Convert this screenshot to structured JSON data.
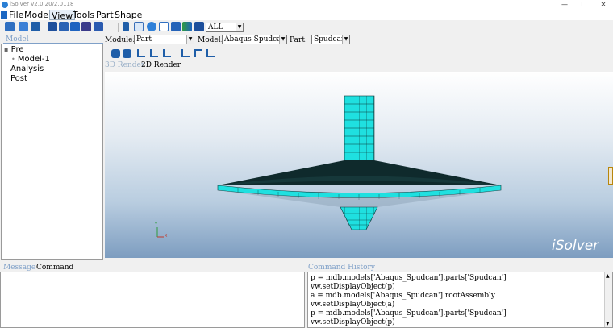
{
  "window": {
    "title": "iSolver v2.0.20/2.0118",
    "controls": [
      "—",
      "☐",
      "✕"
    ]
  },
  "menu": [
    "File",
    "Model",
    "View",
    "Tools",
    "Part",
    "Shape"
  ],
  "toolbar": {
    "filter_value": "ALL"
  },
  "selectors": {
    "module_label": "Module:",
    "module_value": "Part",
    "model_label": "Model:",
    "model_value": "Abaqus Spudcan",
    "part_label": "Part:",
    "part_value": "Spudcan"
  },
  "model_panel": {
    "title": "Model",
    "tree": [
      {
        "label": "Pre",
        "marker": "▪"
      },
      {
        "label": "Model-1",
        "marker": "•"
      },
      {
        "label": "Analysis",
        "marker": ""
      },
      {
        "label": "Post",
        "marker": ""
      }
    ]
  },
  "render_tabs": {
    "tab_3d": "3D Render",
    "tab_2d": "2D Render"
  },
  "viewport": {
    "watermark": "iSolver",
    "axis_labels": [
      "Y",
      "X"
    ]
  },
  "bottom": {
    "message_tab": "Message",
    "command_tab": "Command",
    "history_title": "Command History",
    "history_lines": [
      "p = mdb.models['Abaqus_Spudcan'].parts['Spudcan']",
      "vw.setDisplayObject(p)",
      "a = mdb.models['Abaqus_Spudcan'].rootAssembly",
      "vw.setDisplayObject(a)",
      "p = mdb.models['Abaqus_Spudcan'].parts['Spudcan']",
      "vw.setDisplayObject(p)"
    ]
  },
  "colors": {
    "mesh_fill": "#1fe0e0",
    "mesh_line": "#0a3a3a",
    "accent": "#7fa0c8"
  }
}
